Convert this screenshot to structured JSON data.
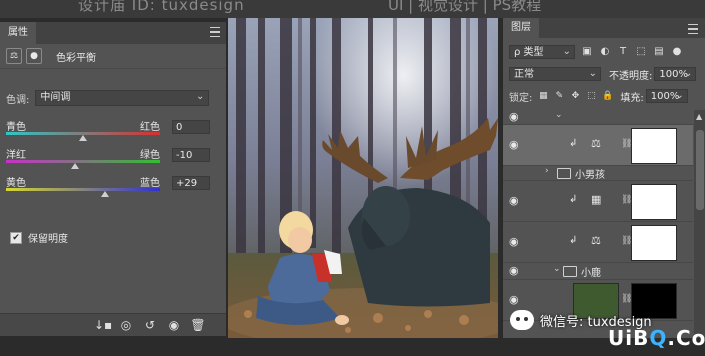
{
  "watermark_top": {
    "left": "设计庙 ID: tuxdesign",
    "right": "UI | 视觉设计 | PS教程"
  },
  "properties_panel": {
    "tab": "属性",
    "close": "«",
    "subtitle": "色彩平衡",
    "tone_label": "色调:",
    "tone_value": "中间调",
    "sliders": [
      {
        "left": "青色",
        "right": "红色",
        "value": "0",
        "level": 0
      },
      {
        "left": "洋红",
        "right": "绿色",
        "value": "-10",
        "level": -10
      },
      {
        "left": "黄色",
        "right": "蓝色",
        "value": "+29",
        "level": 29
      }
    ],
    "preserve_luminosity": "保留明度",
    "preserve_checked": true,
    "slider_colors": {
      "cyan": "#2ec6c6",
      "red": "#d63030",
      "magenta": "#c830c8",
      "green": "#30c030",
      "yellow": "#d8d830",
      "blue": "#3030d0"
    }
  },
  "layers_panel": {
    "tab": "图层",
    "filter_label": "ρ 类型",
    "blend_mode": "正常",
    "opacity_label": "不透明度:",
    "opacity_value": "100%",
    "lock_label": "锁定:",
    "fill_label": "填充:",
    "fill_value": "100%",
    "groups": [
      "小男孩",
      "小鹿"
    ]
  },
  "watermark_bottom": {
    "wechat": "微信号: tuxdesign",
    "logo_a": "UiB",
    "logo_q": "Q",
    "logo_b": ".CoM"
  }
}
